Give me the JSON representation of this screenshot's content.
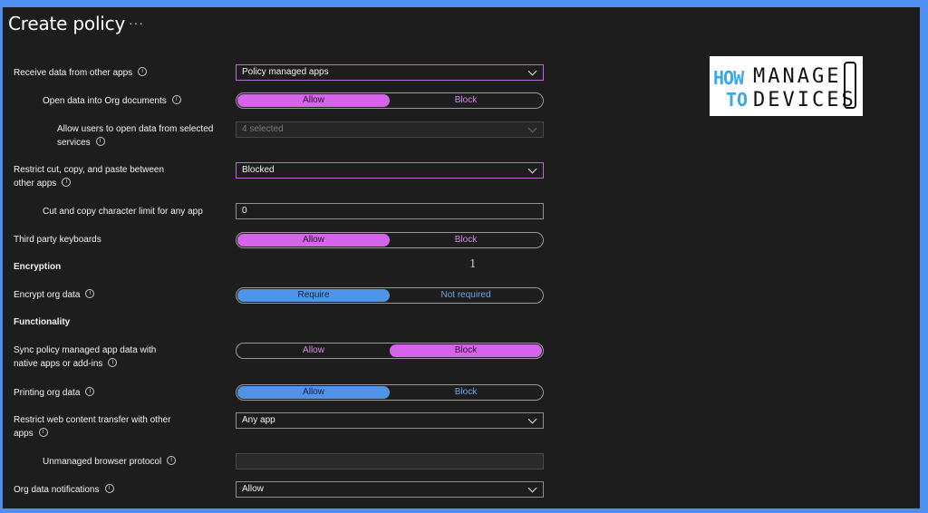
{
  "title": "Create policy",
  "title_more": "···",
  "logo": {
    "how": "HOW",
    "to": "TO",
    "manage": "MANAGE",
    "devices": "DEVICES"
  },
  "stray_text": "1",
  "info_glyph": "i",
  "rows": {
    "receive": {
      "label": "Receive data from other apps",
      "value": "Policy managed apps"
    },
    "open_org": {
      "label": "Open data into Org documents",
      "on": "Allow",
      "off": "Block"
    },
    "allow_services": {
      "label1": "Allow users to open data from selected",
      "label2": "services",
      "value": "4 selected"
    },
    "restrict_ccp": {
      "label1": "Restrict cut, copy, and paste between",
      "label2": "other apps",
      "value": "Blocked"
    },
    "char_limit": {
      "label": "Cut and copy character limit for any app",
      "value": "0"
    },
    "third_party": {
      "label": "Third party keyboards",
      "on": "Allow",
      "off": "Block"
    },
    "encryption_heading": "Encryption",
    "encrypt": {
      "label": "Encrypt org data",
      "on": "Require",
      "off": "Not required"
    },
    "functionality_heading": "Functionality",
    "sync": {
      "label1": "Sync policy managed app data with",
      "label2": "native apps or add-ins",
      "off": "Allow",
      "on": "Block"
    },
    "printing": {
      "label": "Printing org data",
      "on": "Allow",
      "off": "Block"
    },
    "web_transfer": {
      "label1": "Restrict web content transfer with other",
      "label2": "apps",
      "value": "Any app"
    },
    "unmanaged_browser": {
      "label": "Unmanaged browser protocol",
      "value": ""
    },
    "notifications": {
      "label": "Org data notifications",
      "value": "Allow"
    }
  },
  "colors": {
    "accent_purple": "#d664ea",
    "accent_blue": "#4f94e6",
    "background": "#1e1d1d"
  }
}
